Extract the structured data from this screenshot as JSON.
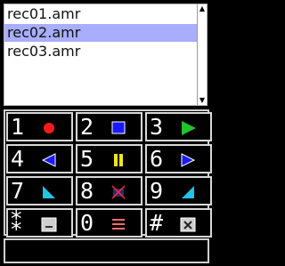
{
  "file_list": {
    "items": [
      "rec01.amr",
      "rec02.amr",
      "rec03.amr"
    ],
    "selected_index": 1
  },
  "scrollbar": {
    "up_glyph": "▲",
    "down_glyph": "▼"
  },
  "keypad": {
    "keys": [
      {
        "digit": "1",
        "icon": "record-icon"
      },
      {
        "digit": "2",
        "icon": "stop-icon"
      },
      {
        "digit": "3",
        "icon": "play-icon"
      },
      {
        "digit": "4",
        "icon": "rewind-icon"
      },
      {
        "digit": "5",
        "icon": "pause-icon"
      },
      {
        "digit": "6",
        "icon": "forward-icon"
      },
      {
        "digit": "7",
        "icon": "volume-down-icon"
      },
      {
        "digit": "8",
        "icon": "mute-icon"
      },
      {
        "digit": "9",
        "icon": "volume-up-icon"
      },
      {
        "digit": "⁑",
        "icon": "minimize-icon"
      },
      {
        "digit": "0",
        "icon": "menu-icon"
      },
      {
        "digit": "#",
        "icon": "close-icon"
      }
    ]
  },
  "colors": {
    "selection": "#a8aefb",
    "record": "#ff1a1a",
    "stop": "#1a1aff",
    "play": "#22c42e",
    "pause": "#f2e21a",
    "volume": "#22c3e6",
    "menu": "#ff6b6b"
  },
  "status_text": ""
}
